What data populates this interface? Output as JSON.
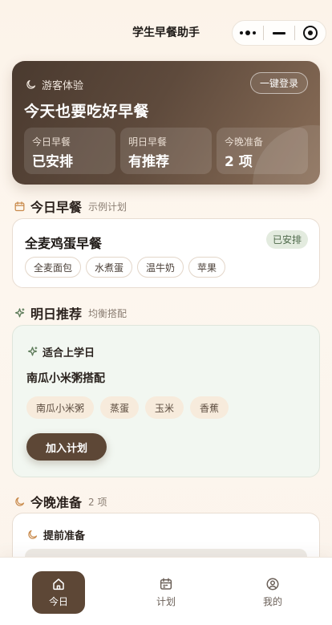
{
  "navbar": {
    "title": "学生早餐助手",
    "capsule_icons": [
      "more-dots-icon",
      "minimize-icon",
      "close-target-icon"
    ]
  },
  "hero": {
    "tag": "游客体验",
    "tag_icon": "moon-icon",
    "login_label": "一键登录",
    "title": "今天也要吃好早餐",
    "stats": [
      {
        "label": "今日早餐",
        "value": "已安排"
      },
      {
        "label": "明日早餐",
        "value": "有推荐"
      },
      {
        "label": "今晚准备",
        "value": "2 项"
      }
    ]
  },
  "today": {
    "section_title": "今日早餐",
    "section_sub": "示例计划",
    "section_icon": "calendar-icon",
    "meal_name": "全麦鸡蛋早餐",
    "status": "已安排",
    "items": [
      "全麦面包",
      "水煮蛋",
      "温牛奶",
      "苹果"
    ]
  },
  "tomorrow": {
    "section_title": "明日推荐",
    "section_sub": "均衡搭配",
    "section_icon": "sparkle-icon",
    "tag": "适合上学日",
    "meal_name": "南瓜小米粥搭配",
    "items": [
      "南瓜小米粥",
      "蒸蛋",
      "玉米",
      "香蕉"
    ],
    "add_label": "加入计划"
  },
  "tonight": {
    "section_title": "今晚准备",
    "section_sub": "2 项",
    "section_icon": "moon-icon",
    "tag": "提前准备"
  },
  "tabbar": {
    "tabs": [
      {
        "label": "今日",
        "icon": "home-icon",
        "active": true
      },
      {
        "label": "计划",
        "icon": "calendar-icon",
        "active": false
      },
      {
        "label": "我的",
        "icon": "user-icon",
        "active": false
      }
    ]
  },
  "colors": {
    "brand_brown": "#5d4736",
    "badge_green_bg": "#e3ebdf",
    "chip_peach": "#f7ebdc",
    "rec_bg": "#f2f7f1"
  }
}
